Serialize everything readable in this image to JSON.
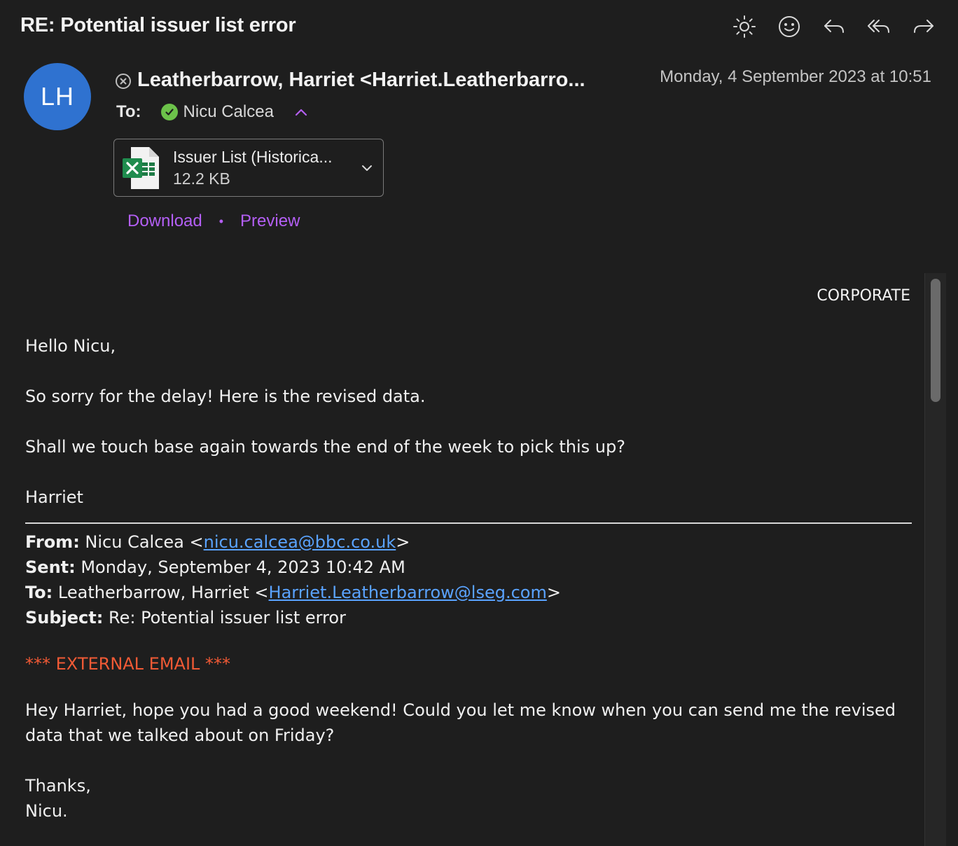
{
  "header": {
    "subject": "RE: Potential issuer list error",
    "toolbar": {
      "theme_icon": "sun-icon",
      "react_icon": "smiley-icon",
      "reply_icon": "reply-icon",
      "reply_all_icon": "reply-all-icon",
      "forward_icon": "forward-icon"
    }
  },
  "message": {
    "avatar_initials": "LH",
    "avatar_color": "#2f72d0",
    "sender": "Leatherbarrow, Harriet <Harriet.Leatherbarro...",
    "date": "Monday, 4 September 2023 at 10:51",
    "to_label": "To:",
    "recipient": "Nicu Calcea"
  },
  "attachment": {
    "name": "Issuer List (Historica...",
    "size": "12.2 KB",
    "download_label": "Download",
    "separator": "•",
    "preview_label": "Preview",
    "accent_color": "#b45ff5"
  },
  "body": {
    "classification": "CORPORATE",
    "greeting": "Hello Nicu,",
    "line1": "So sorry for the delay! Here is the revised data.",
    "line2": "Shall we touch base again towards the end of the week to pick this up?",
    "signoff": "Harriet",
    "quoted": {
      "from_label": "From:",
      "from_name": " Nicu Calcea <",
      "from_email": "nicu.calcea@bbc.co.uk",
      "from_close": ">",
      "sent_label": "Sent:",
      "sent_value": " Monday, September 4, 2023 10:42 AM",
      "to_label": "To:",
      "to_name": " Leatherbarrow, Harriet <",
      "to_email": "Harriet.Leatherbarrow@lseg.com",
      "to_close": ">",
      "subject_label": "Subject:",
      "subject_value": " Re: Potential issuer list error",
      "external_notice": "*** EXTERNAL EMAIL ***",
      "message": "Hey Harriet, hope you had a good weekend! Could you let me know when you can send me the revised data that we talked about on Friday?",
      "thanks": "Thanks,",
      "name": "Nicu."
    }
  }
}
